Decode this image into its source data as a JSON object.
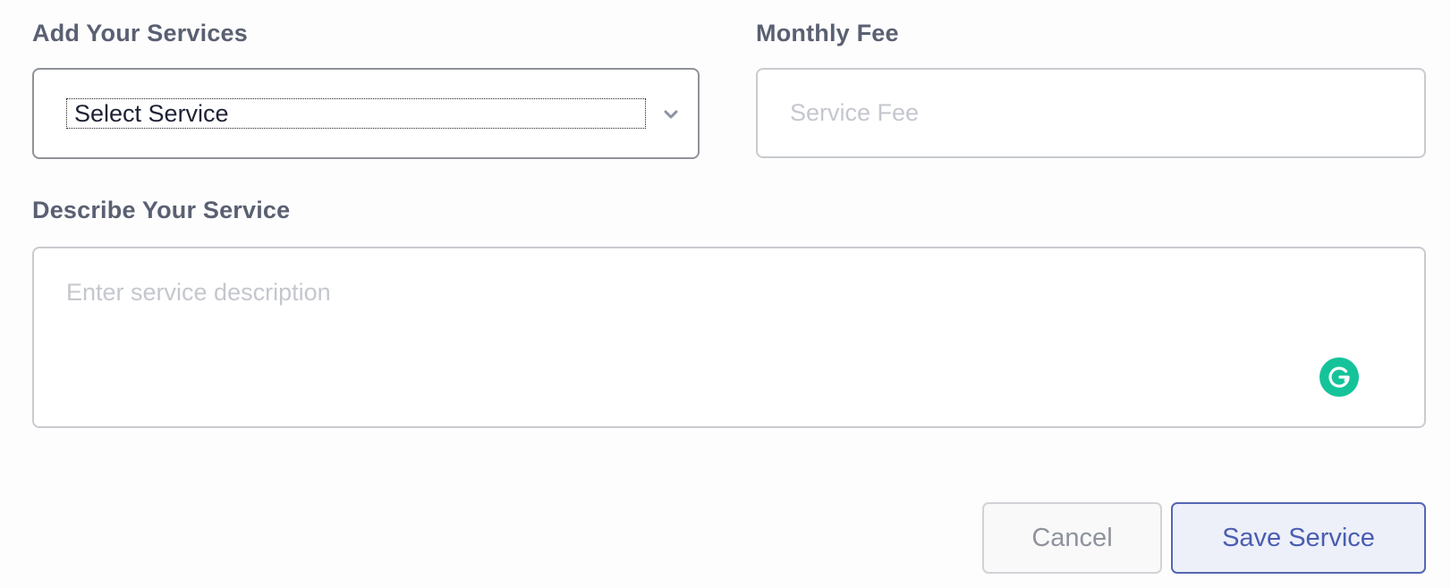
{
  "form": {
    "services_label": "Add Your Services",
    "fee_label": "Monthly Fee",
    "describe_label": "Describe Your Service",
    "service_select": {
      "selected": "Select Service"
    },
    "fee_input": {
      "value": "",
      "placeholder": "Service Fee"
    },
    "description_input": {
      "value": "",
      "placeholder": "Enter service description"
    }
  },
  "buttons": {
    "cancel_label": "Cancel",
    "save_label": "Save Service"
  },
  "colors": {
    "label": "#5a6072",
    "placeholder": "#c5c7ce",
    "primary": "#4a5db0",
    "grammarly": "#15c39a"
  },
  "icons": {
    "select_arrow": "chevron-down-icon",
    "assistant": "grammarly-icon"
  }
}
